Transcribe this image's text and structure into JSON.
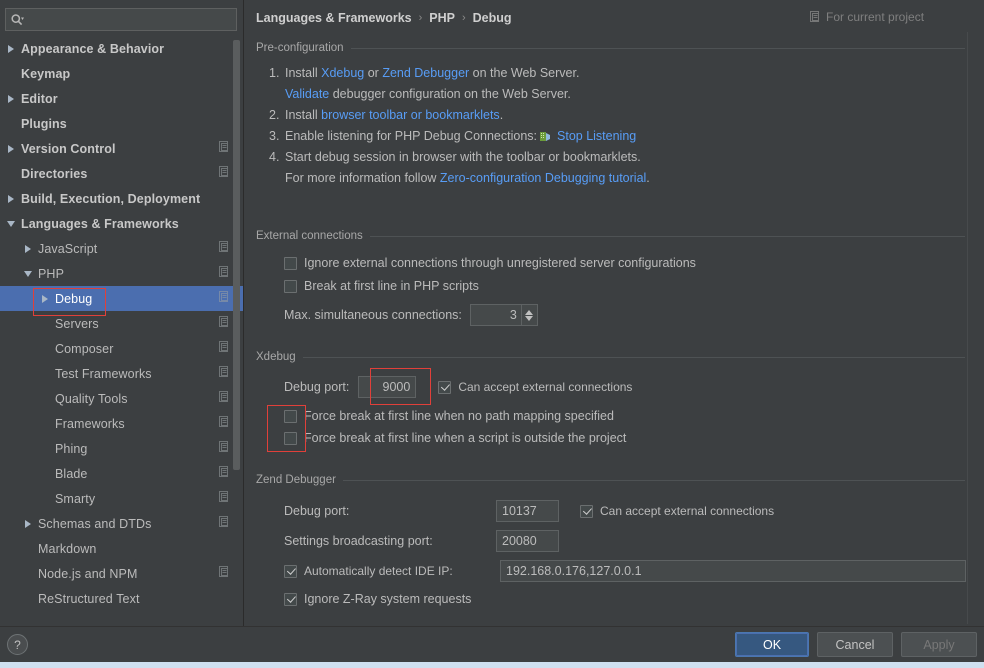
{
  "search": {
    "value": "",
    "placeholder": ""
  },
  "sidebar": {
    "items": [
      {
        "label": "Appearance & Behavior",
        "indent": 0,
        "arrow": "collapsed",
        "bold": true,
        "module": false,
        "selected": false
      },
      {
        "label": "Keymap",
        "indent": 0,
        "arrow": "none",
        "bold": true,
        "module": false,
        "selected": false
      },
      {
        "label": "Editor",
        "indent": 0,
        "arrow": "collapsed",
        "bold": true,
        "module": false,
        "selected": false
      },
      {
        "label": "Plugins",
        "indent": 0,
        "arrow": "none",
        "bold": true,
        "module": false,
        "selected": false
      },
      {
        "label": "Version Control",
        "indent": 0,
        "arrow": "collapsed",
        "bold": true,
        "module": true,
        "selected": false
      },
      {
        "label": "Directories",
        "indent": 0,
        "arrow": "none",
        "bold": true,
        "module": true,
        "selected": false
      },
      {
        "label": "Build, Execution, Deployment",
        "indent": 0,
        "arrow": "collapsed",
        "bold": true,
        "module": false,
        "selected": false
      },
      {
        "label": "Languages & Frameworks",
        "indent": 0,
        "arrow": "expanded",
        "bold": true,
        "module": false,
        "selected": false
      },
      {
        "label": "JavaScript",
        "indent": 1,
        "arrow": "collapsed",
        "bold": false,
        "module": true,
        "selected": false
      },
      {
        "label": "PHP",
        "indent": 1,
        "arrow": "expanded",
        "bold": false,
        "module": true,
        "selected": false
      },
      {
        "label": "Debug",
        "indent": 2,
        "arrow": "collapsed",
        "bold": false,
        "module": true,
        "selected": true
      },
      {
        "label": "Servers",
        "indent": 2,
        "arrow": "none",
        "bold": false,
        "module": true,
        "selected": false
      },
      {
        "label": "Composer",
        "indent": 2,
        "arrow": "none",
        "bold": false,
        "module": true,
        "selected": false
      },
      {
        "label": "Test Frameworks",
        "indent": 2,
        "arrow": "none",
        "bold": false,
        "module": true,
        "selected": false
      },
      {
        "label": "Quality Tools",
        "indent": 2,
        "arrow": "none",
        "bold": false,
        "module": true,
        "selected": false
      },
      {
        "label": "Frameworks",
        "indent": 2,
        "arrow": "none",
        "bold": false,
        "module": true,
        "selected": false
      },
      {
        "label": "Phing",
        "indent": 2,
        "arrow": "none",
        "bold": false,
        "module": true,
        "selected": false
      },
      {
        "label": "Blade",
        "indent": 2,
        "arrow": "none",
        "bold": false,
        "module": true,
        "selected": false
      },
      {
        "label": "Smarty",
        "indent": 2,
        "arrow": "none",
        "bold": false,
        "module": true,
        "selected": false
      },
      {
        "label": "Schemas and DTDs",
        "indent": 1,
        "arrow": "collapsed",
        "bold": false,
        "module": true,
        "selected": false
      },
      {
        "label": "Markdown",
        "indent": 1,
        "arrow": "none",
        "bold": false,
        "module": false,
        "selected": false
      },
      {
        "label": "Node.js and NPM",
        "indent": 1,
        "arrow": "none",
        "bold": false,
        "module": true,
        "selected": false
      },
      {
        "label": "ReStructured Text",
        "indent": 1,
        "arrow": "none",
        "bold": false,
        "module": false,
        "selected": false
      }
    ]
  },
  "breadcrumb": {
    "crumbs": [
      "Languages & Frameworks",
      "PHP",
      "Debug"
    ],
    "separator": "›",
    "scope_label": "For current project"
  },
  "preconfig": {
    "title": "Pre-configuration",
    "step1": {
      "num": "1.",
      "pre": "Install ",
      "link1": "Xdebug",
      "mid": " or ",
      "link2": "Zend Debugger",
      "post": " on the Web Server."
    },
    "step1b": {
      "link": "Validate",
      "post": " debugger configuration on the Web Server."
    },
    "step2": {
      "num": "2.",
      "pre": "Install ",
      "link": "browser toolbar or bookmarklets",
      "post": "."
    },
    "step3": {
      "num": "3.",
      "pre": "Enable listening for PHP Debug Connections:",
      "link": "Stop Listening"
    },
    "step4": {
      "num": "4.",
      "text": "Start debug session in browser with the toolbar or bookmarklets."
    },
    "step4b": {
      "pre": "For more information follow ",
      "link": "Zero-configuration Debugging tutorial",
      "post": "."
    }
  },
  "external": {
    "title": "External connections",
    "ignore_unregistered": {
      "label": "Ignore external connections through unregistered server configurations",
      "checked": false
    },
    "break_first_line": {
      "label": "Break at first line in PHP scripts",
      "checked": false
    },
    "max_connections": {
      "label": "Max. simultaneous connections:",
      "value": "3"
    }
  },
  "xdebug": {
    "title": "Xdebug",
    "debug_port_label": "Debug port:",
    "debug_port_value": "9000",
    "can_accept": {
      "label": "Can accept external connections",
      "checked": true
    },
    "force_no_mapping": {
      "label": "Force break at first line when no path mapping specified",
      "checked": false
    },
    "force_outside_proj": {
      "label": "Force break at first line when a script is outside the project",
      "checked": false
    }
  },
  "zend": {
    "title": "Zend Debugger",
    "debug_port_label": "Debug port:",
    "debug_port_value": "10137",
    "can_accept": {
      "label": "Can accept external connections",
      "checked": true
    },
    "broadcast_label": "Settings broadcasting port:",
    "broadcast_value": "20080",
    "auto_detect": {
      "label": "Automatically detect IDE IP:",
      "checked": true
    },
    "ide_ip_value": "192.168.0.176,127.0.0.1",
    "ignore_zray": {
      "label": "Ignore Z-Ray system requests",
      "checked": true
    }
  },
  "footer": {
    "help_label": "?",
    "ok_label": "OK",
    "cancel_label": "Cancel",
    "apply_label": "Apply"
  },
  "colors": {
    "background": "#3c3f41",
    "selection": "#4b6eaf",
    "link": "#589df6",
    "annotation": "#e0403a",
    "ok_button": "#365880",
    "text": "#bbbbbb"
  }
}
